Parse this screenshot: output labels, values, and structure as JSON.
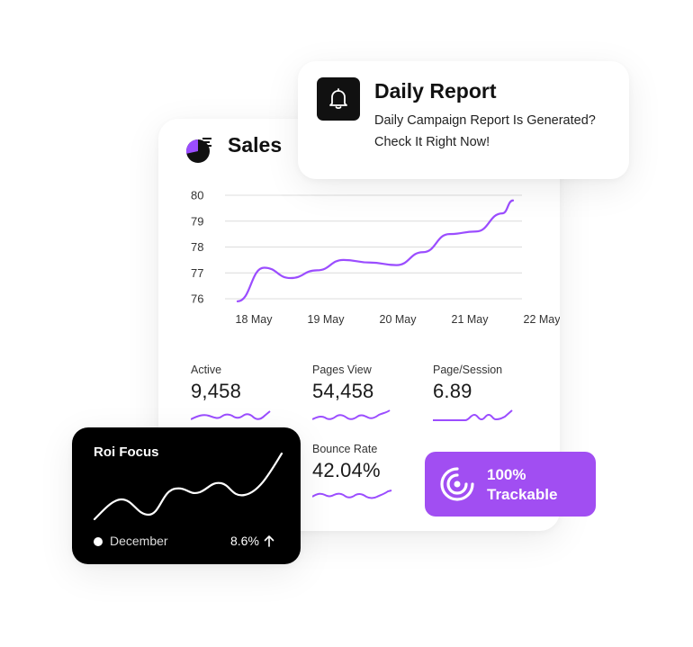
{
  "sales": {
    "title": "Sales",
    "chart_data": {
      "type": "line",
      "categories": [
        "18 May",
        "19 May",
        "20 May",
        "21 May",
        "22 May"
      ],
      "y_ticks": [
        "80",
        "79",
        "78",
        "77",
        "76"
      ],
      "ylim": [
        76,
        80
      ],
      "x": [
        0,
        0.5,
        1,
        1.5,
        2,
        2.5,
        3,
        3.5,
        4,
        4.5,
        5,
        5.2
      ],
      "values": [
        75.9,
        77.2,
        76.8,
        77.1,
        77.5,
        77.4,
        77.3,
        77.8,
        78.5,
        78.6,
        79.3,
        79.8
      ],
      "series_color": "#9b4dff"
    },
    "metrics": [
      {
        "label": "Active",
        "value": "9,458"
      },
      {
        "label": "Pages View",
        "value": "54,458"
      },
      {
        "label": "Page/Session",
        "value": "6.89"
      },
      {
        "label": "Bounce Rate",
        "value": "42.04%"
      }
    ]
  },
  "report": {
    "title": "Daily Report",
    "line1": "Daily Campaign Report Is Generated?",
    "line2": "Check It Right Now!",
    "icon": "bell-icon"
  },
  "roi": {
    "title": "Roi Focus",
    "month": "December",
    "percent": "8.6%",
    "trend_icon": "arrow-up-icon"
  },
  "trackable": {
    "line1": "100%",
    "line2": "Trackable",
    "icon": "target-icon",
    "color": "#a14ef2"
  },
  "accent": "#9b4dff"
}
